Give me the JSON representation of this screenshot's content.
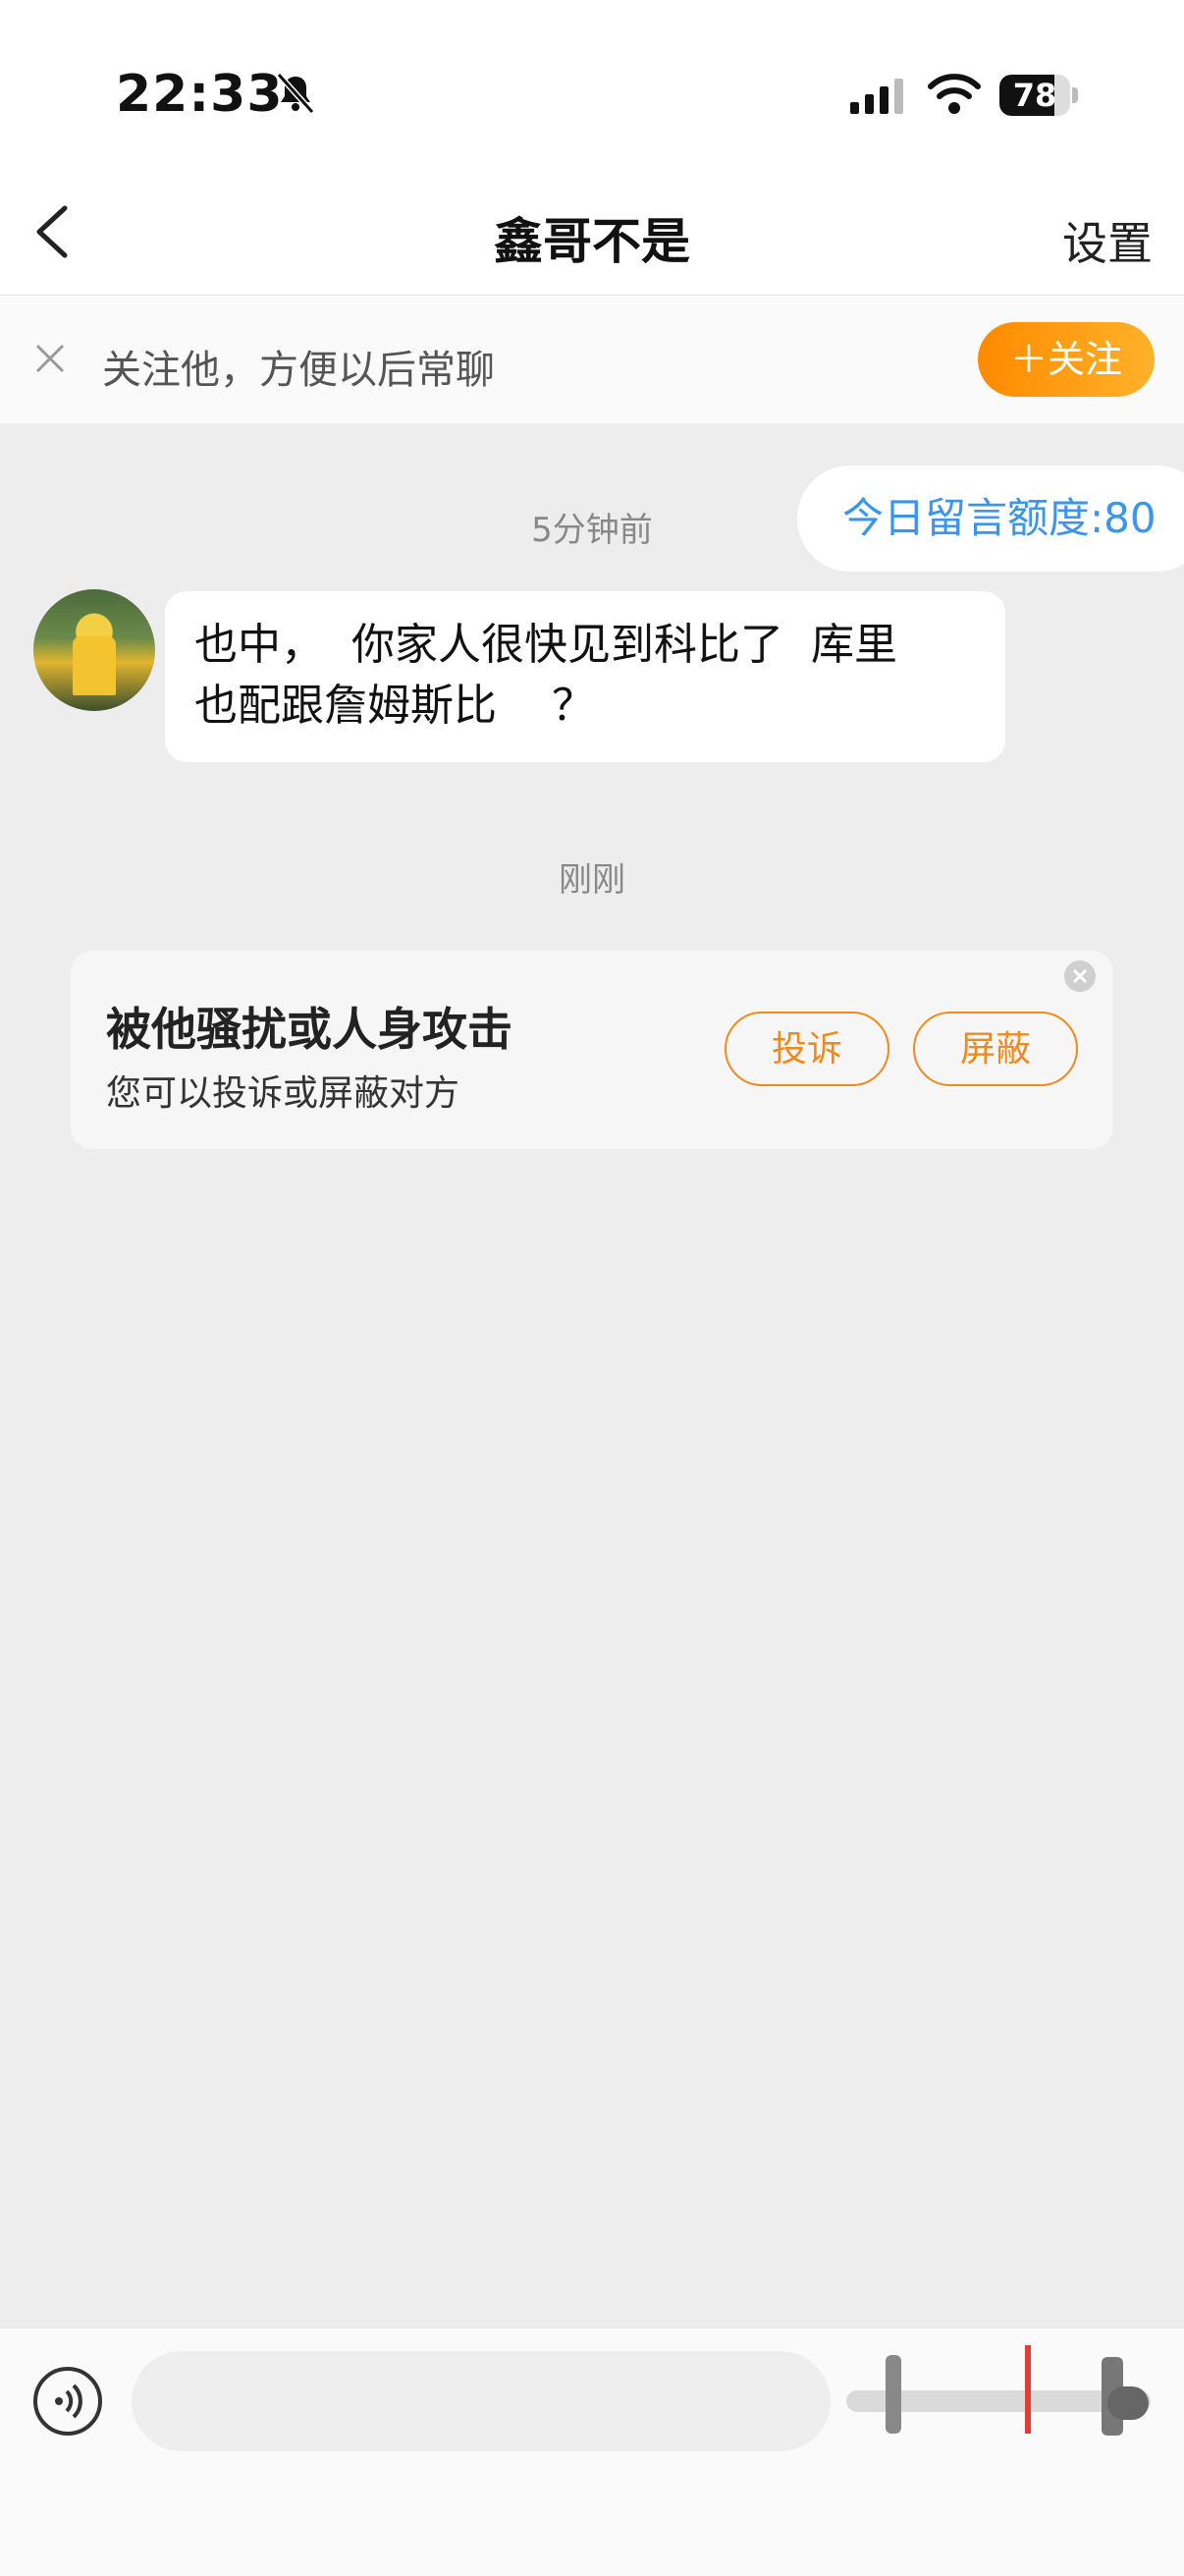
{
  "status_bar": {
    "time": "22:33",
    "battery": 78,
    "icons": [
      "bell-muted-icon",
      "signal-icon",
      "wifi-icon",
      "battery-icon"
    ]
  },
  "nav": {
    "title": "鑫哥不是",
    "settings_label": "设置",
    "back_icon": "chevron-left-icon"
  },
  "follow_bar": {
    "text": "关注他，方便以后常聊",
    "button_label": "＋关注",
    "close_icon": "close-icon"
  },
  "chat": {
    "quota_label": "今日留言额度:80",
    "messages": [
      {
        "timestamp": "5分钟前",
        "text": "也中，  你家人很快见到科比了  库里\n也配跟詹姆斯比    ？",
        "sender": "other"
      }
    ],
    "second_timestamp": "刚刚"
  },
  "report_card": {
    "title": "被他骚扰或人身攻击",
    "subtitle": "您可以投诉或屏蔽对方",
    "report_label": "投诉",
    "block_label": "屏蔽"
  },
  "input_bar": {
    "placeholder": "",
    "voice_icon": "voice-icon"
  },
  "colors": {
    "accent_orange": "#ff9a17",
    "quota_blue": "#3a95f0",
    "background": "#ededed"
  }
}
